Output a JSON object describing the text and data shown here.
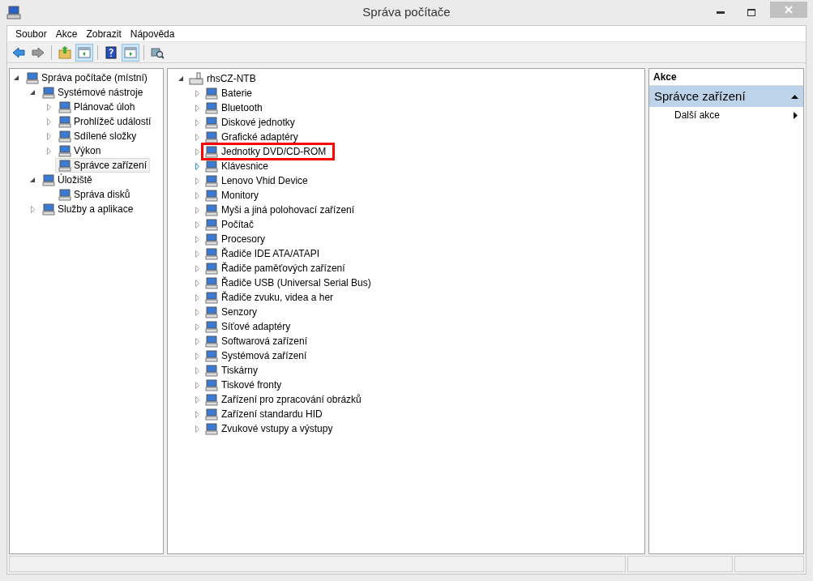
{
  "window": {
    "title": "Správa počítače"
  },
  "menu": [
    "Soubor",
    "Akce",
    "Zobrazit",
    "Nápověda"
  ],
  "toolbar": [
    {
      "kind": "back",
      "pressed": false
    },
    {
      "kind": "forward",
      "pressed": false
    },
    {
      "kind": "separator"
    },
    {
      "kind": "up",
      "pressed": false
    },
    {
      "kind": "tree-pane",
      "pressed": true
    },
    {
      "kind": "separator"
    },
    {
      "kind": "help",
      "pressed": false
    },
    {
      "kind": "action-pane",
      "pressed": true
    },
    {
      "kind": "separator"
    },
    {
      "kind": "scan",
      "pressed": false
    }
  ],
  "console_tree": [
    {
      "label": "Správa počítače (místní)",
      "selected": false,
      "expanded": true,
      "children": [
        {
          "label": "Systémové nástroje",
          "selected": false,
          "expanded": true,
          "children": [
            {
              "label": "Plánovač úloh",
              "selected": false,
              "expanded": false
            },
            {
              "label": "Prohlížeč událostí",
              "selected": false,
              "expanded": false
            },
            {
              "label": "Sdílené složky",
              "selected": false,
              "expanded": false
            },
            {
              "label": "Výkon",
              "selected": false,
              "expanded": false
            },
            {
              "label": "Správce zařízení",
              "selected": true
            }
          ]
        },
        {
          "label": "Úložiště",
          "selected": false,
          "expanded": true,
          "children": [
            {
              "label": "Správa disků",
              "selected": false
            }
          ]
        },
        {
          "label": "Služby a aplikace",
          "selected": false,
          "expanded": false
        }
      ]
    }
  ],
  "device_tree": {
    "computer": "rhsCZ-NTB",
    "expanded": true,
    "categories": [
      {
        "label": "Baterie",
        "hovered": false,
        "highlighted": false
      },
      {
        "label": "Bluetooth",
        "hovered": false,
        "highlighted": false
      },
      {
        "label": "Diskové jednotky",
        "hovered": false,
        "highlighted": false
      },
      {
        "label": "Grafické adaptéry",
        "hovered": false,
        "highlighted": false
      },
      {
        "label": "Jednotky DVD/CD-ROM",
        "hovered": false,
        "highlighted": true
      },
      {
        "label": "Klávesnice",
        "hovered": true,
        "highlighted": false
      },
      {
        "label": "Lenovo Vhid Device",
        "hovered": false,
        "highlighted": false
      },
      {
        "label": "Monitory",
        "hovered": false,
        "highlighted": false
      },
      {
        "label": "Myši a jiná polohovací zařízení",
        "hovered": false,
        "highlighted": false
      },
      {
        "label": "Počítač",
        "hovered": false,
        "highlighted": false
      },
      {
        "label": "Procesory",
        "hovered": false,
        "highlighted": false
      },
      {
        "label": "Řadiče IDE ATA/ATAPI",
        "hovered": false,
        "highlighted": false
      },
      {
        "label": "Řadiče paměťových zařízení",
        "hovered": false,
        "highlighted": false
      },
      {
        "label": "Řadiče USB (Universal Serial Bus)",
        "hovered": false,
        "highlighted": false
      },
      {
        "label": "Řadiče zvuku, videa a her",
        "hovered": false,
        "highlighted": false
      },
      {
        "label": "Senzory",
        "hovered": false,
        "highlighted": false
      },
      {
        "label": "Síťové adaptéry",
        "hovered": false,
        "highlighted": false
      },
      {
        "label": "Softwarová zařízení",
        "hovered": false,
        "highlighted": false
      },
      {
        "label": "Systémová zařízení",
        "hovered": false,
        "highlighted": false
      },
      {
        "label": "Tiskárny",
        "hovered": false,
        "highlighted": false
      },
      {
        "label": "Tiskové fronty",
        "hovered": false,
        "highlighted": false
      },
      {
        "label": "Zařízení pro zpracování obrázků",
        "hovered": false,
        "highlighted": false
      },
      {
        "label": "Zařízení standardu HID",
        "hovered": false,
        "highlighted": false
      },
      {
        "label": "Zvukové vstupy a výstupy",
        "hovered": false,
        "highlighted": false
      }
    ]
  },
  "actions": {
    "header": "Akce",
    "section": {
      "title": "Správce zařízení",
      "expanded": true,
      "items": [
        "Další akce"
      ]
    }
  }
}
